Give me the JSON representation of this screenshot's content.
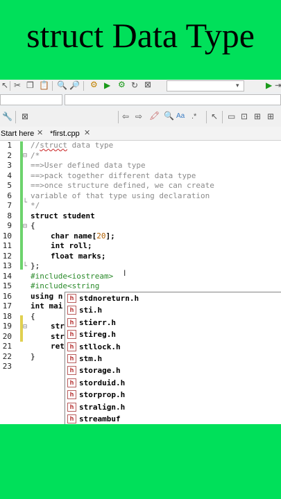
{
  "banner": {
    "title": "struct Data Type"
  },
  "tabs": [
    {
      "label": "Start here"
    },
    {
      "label": "*first.cpp"
    }
  ],
  "line_numbers": [
    "1",
    "2",
    "3",
    "4",
    "5",
    "6",
    "7",
    "8",
    "9",
    "10",
    "11",
    "12",
    "13",
    "14",
    "15",
    "16",
    "17",
    "18",
    "19",
    "20",
    "21",
    "22",
    "23"
  ],
  "code": {
    "l1_a": "//",
    "l1_b": "struct",
    "l1_c": " data type",
    "l2": "/*",
    "l3": "==>User defined data type",
    "l4": "==>pack together different data type",
    "l5": "==>once structure defined, we can create",
    "l6": "variable of that type using declaration",
    "l7": "*/",
    "l8": "struct student",
    "l9": "{",
    "l10_kw": "char",
    "l10_a": " name[",
    "l10_num": "20",
    "l10_b": "];",
    "l11_kw": "int",
    "l11_a": " roll;",
    "l12_kw": "float",
    "l12_a": " marks;",
    "l13": "};",
    "l14": "#include<iostream>",
    "l15": "#include<string",
    "l16": "using n",
    "l17": "int mai",
    "l18": "{",
    "l19": "str",
    "l20": "str",
    "l21": "ret",
    "l22": "}"
  },
  "autocomplete": {
    "icon_letter": "h",
    "items": [
      "stdnoreturn.h",
      "sti.h",
      "stierr.h",
      "stireg.h",
      "stllock.h",
      "stm.h",
      "storage.h",
      "storduid.h",
      "storprop.h",
      "stralign.h",
      "streambuf"
    ]
  },
  "colors": {
    "banner": "#00e05a",
    "header_icon": "#b02020"
  }
}
